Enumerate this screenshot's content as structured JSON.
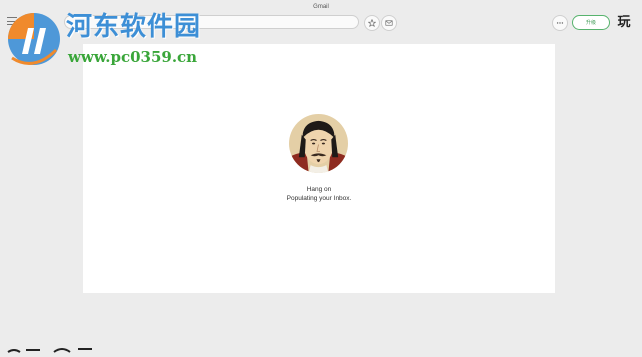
{
  "window": {
    "title": "Gmail"
  },
  "toolbar": {
    "menu_icon": "hamburger-menu-icon",
    "star_icon": "star-icon",
    "mail_icon": "mail-icon",
    "more_icon": "more-dots-icon",
    "action_button_label": "升级",
    "corner_glyph": "玩"
  },
  "loading": {
    "title": "Hang on",
    "subtitle": "Populating your Inbox."
  },
  "watermark": {
    "title": "河东软件园",
    "url": "www.pc0359.cn"
  },
  "colors": {
    "accent_green": "#57b36d",
    "watermark_blue": "#3d8fd6",
    "watermark_green": "#3aa63a",
    "background": "#ececec"
  }
}
